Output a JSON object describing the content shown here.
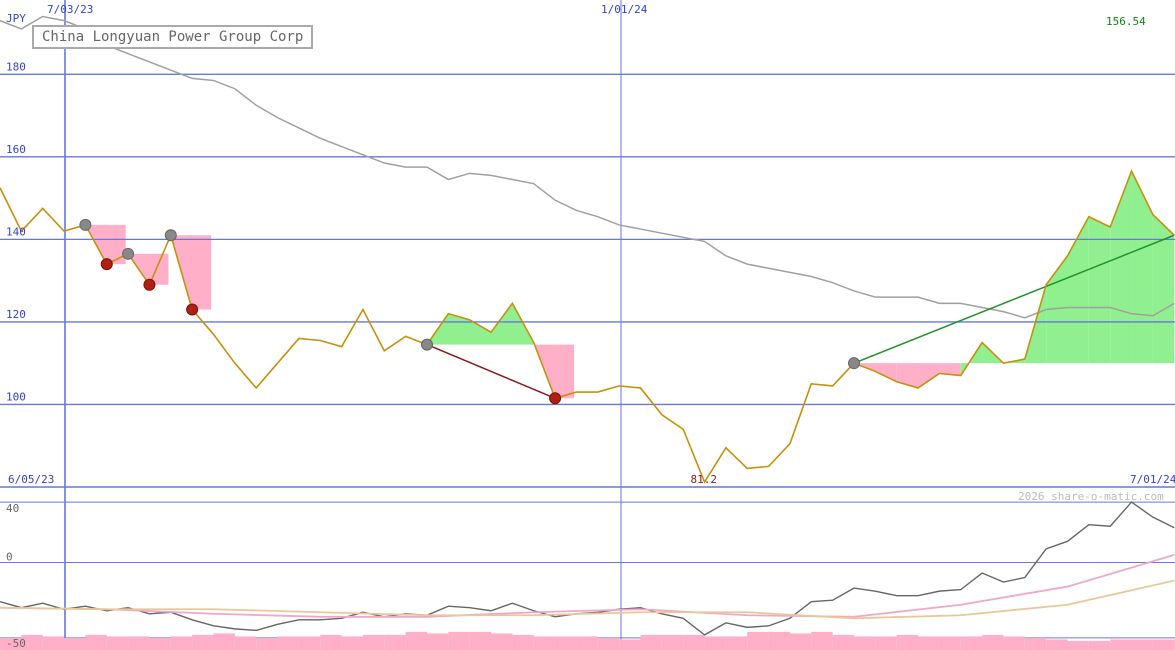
{
  "title": "China Longyuan Power Group Corp",
  "copyright": "2026 share-o-matic.com",
  "colors": {
    "price": "#c8900a",
    "ma_long": "#a0a0a0",
    "grid": "#6677dd",
    "up_fill": "#90f090",
    "down_fill": "#ffb0c8",
    "up_trend": "#22922a",
    "down_trend": "#8b1a1a",
    "last_price": "#118811",
    "low_label": "#8b1a1a"
  },
  "chart_data": [
    {
      "type": "line",
      "panel": "price",
      "ylabel": "JPY",
      "y_ticks": [
        100,
        120,
        140,
        160,
        180
      ],
      "ylim": [
        80,
        198
      ],
      "xlim": [
        "6/05/23",
        "7/01/24"
      ],
      "date_labels": [
        "6/05/23",
        "7/03/23",
        "1/01/24",
        "7/01/24"
      ],
      "date_lines": [
        "7/03/23",
        "1/01/24"
      ],
      "last_price_label": "156.54",
      "low_label": "81.2",
      "series": [
        {
          "role": "price",
          "values": [
            [
              0,
              152.5
            ],
            [
              1,
              142
            ],
            [
              2,
              147.5
            ],
            [
              3,
              142
            ],
            [
              4,
              143.5
            ],
            [
              5,
              134
            ],
            [
              6,
              136.5
            ],
            [
              7,
              129
            ],
            [
              8,
              141
            ],
            [
              9,
              123
            ],
            [
              10,
              117
            ],
            [
              11,
              110
            ],
            [
              12,
              104
            ],
            [
              13,
              110
            ],
            [
              14,
              116
            ],
            [
              15,
              115.5
            ],
            [
              16,
              114
            ],
            [
              17,
              123
            ],
            [
              18,
              113
            ],
            [
              19,
              116.5
            ],
            [
              20,
              114.5
            ],
            [
              21,
              122
            ],
            [
              22,
              120.5
            ],
            [
              23,
              117.5
            ],
            [
              24,
              124.5
            ],
            [
              25,
              115
            ],
            [
              26,
              101.5
            ],
            [
              27,
              103
            ],
            [
              28,
              103
            ],
            [
              29,
              104.5
            ],
            [
              30,
              104
            ],
            [
              31,
              97.5
            ],
            [
              32,
              94
            ],
            [
              33,
              81.2
            ],
            [
              34,
              89.5
            ],
            [
              35,
              84.5
            ],
            [
              36,
              85
            ],
            [
              37,
              90.5
            ],
            [
              38,
              105
            ],
            [
              39,
              104.5
            ],
            [
              40,
              110
            ],
            [
              41,
              108
            ],
            [
              42,
              105.5
            ],
            [
              43,
              104
            ],
            [
              44,
              107.5
            ],
            [
              45,
              107
            ],
            [
              46,
              115
            ],
            [
              47,
              110
            ],
            [
              48,
              111
            ],
            [
              49,
              129
            ],
            [
              50,
              136
            ],
            [
              51,
              145.5
            ],
            [
              52,
              143
            ],
            [
              53,
              156.54
            ],
            [
              54,
              146
            ],
            [
              55,
              141
            ]
          ]
        },
        {
          "role": "long_moving_average",
          "values": [
            [
              0,
              193
            ],
            [
              1,
              191
            ],
            [
              2,
              194
            ],
            [
              3,
              193
            ],
            [
              4,
              191
            ],
            [
              5,
              187
            ],
            [
              6,
              185
            ],
            [
              7,
              183
            ],
            [
              8,
              181
            ],
            [
              9,
              179
            ],
            [
              10,
              178.5
            ],
            [
              11,
              176.5
            ],
            [
              12,
              172.5
            ],
            [
              13,
              169.5
            ],
            [
              14,
              167
            ],
            [
              15,
              164.5
            ],
            [
              16,
              162.5
            ],
            [
              17,
              160.5
            ],
            [
              18,
              158.5
            ],
            [
              19,
              157.5
            ],
            [
              20,
              157.5
            ],
            [
              21,
              154.5
            ],
            [
              22,
              156
            ],
            [
              23,
              155.5
            ],
            [
              24,
              154.5
            ],
            [
              25,
              153.5
            ],
            [
              26,
              149.5
            ],
            [
              27,
              147
            ],
            [
              28,
              145.5
            ],
            [
              29,
              143.5
            ],
            [
              30,
              142.5
            ],
            [
              31,
              141.5
            ],
            [
              32,
              140.5
            ],
            [
              33,
              139.5
            ],
            [
              34,
              136
            ],
            [
              35,
              134
            ],
            [
              36,
              133
            ],
            [
              37,
              132
            ],
            [
              38,
              131
            ],
            [
              39,
              129.5
            ],
            [
              40,
              127.5
            ],
            [
              41,
              126
            ],
            [
              42,
              126
            ],
            [
              43,
              126
            ],
            [
              44,
              124.5
            ],
            [
              45,
              124.5
            ],
            [
              46,
              123.5
            ],
            [
              47,
              122.5
            ],
            [
              48,
              121
            ],
            [
              49,
              123
            ],
            [
              50,
              123.5
            ],
            [
              51,
              123.5
            ],
            [
              52,
              123.5
            ],
            [
              53,
              122
            ],
            [
              54,
              121.5
            ],
            [
              55,
              124.5
            ]
          ]
        }
      ],
      "signals": [
        {
          "kind": "sell",
          "from": [
            4,
            143.5
          ],
          "to": [
            5,
            134
          ]
        },
        {
          "kind": "sell",
          "from": [
            6,
            136.5
          ],
          "to": [
            7,
            129
          ]
        },
        {
          "kind": "sell",
          "from": [
            8,
            141
          ],
          "to": [
            9,
            123
          ]
        },
        {
          "kind": "sell",
          "from": [
            20,
            114.5
          ],
          "to": [
            26,
            101.5
          ]
        },
        {
          "kind": "buy",
          "from": [
            40,
            110
          ],
          "to": [
            55,
            141
          ]
        }
      ]
    },
    {
      "type": "line",
      "panel": "oscillator",
      "y_ticks": [
        -50,
        0,
        40
      ],
      "ylim": [
        -58,
        48
      ],
      "series": [
        {
          "role": "oscillator",
          "values": [
            [
              0,
              -26
            ],
            [
              1,
              -30
            ],
            [
              2,
              -27
            ],
            [
              3,
              -31
            ],
            [
              4,
              -29
            ],
            [
              5,
              -32
            ],
            [
              6,
              -30
            ],
            [
              7,
              -34
            ],
            [
              8,
              -33
            ],
            [
              9,
              -38
            ],
            [
              10,
              -42
            ],
            [
              11,
              -44
            ],
            [
              12,
              -45
            ],
            [
              13,
              -41
            ],
            [
              14,
              -38
            ],
            [
              15,
              -38
            ],
            [
              16,
              -37
            ],
            [
              17,
              -33
            ],
            [
              18,
              -36
            ],
            [
              19,
              -34
            ],
            [
              20,
              -35
            ],
            [
              21,
              -29
            ],
            [
              22,
              -30
            ],
            [
              23,
              -32
            ],
            [
              24,
              -27
            ],
            [
              25,
              -32
            ],
            [
              26,
              -36
            ],
            [
              27,
              -34
            ],
            [
              28,
              -33
            ],
            [
              29,
              -31
            ],
            [
              30,
              -30
            ],
            [
              31,
              -34
            ],
            [
              32,
              -37
            ],
            [
              33,
              -48
            ],
            [
              34,
              -40
            ],
            [
              35,
              -43
            ],
            [
              36,
              -42
            ],
            [
              37,
              -37
            ],
            [
              38,
              -26
            ],
            [
              39,
              -25
            ],
            [
              40,
              -17
            ],
            [
              41,
              -19
            ],
            [
              42,
              -22
            ],
            [
              43,
              -22
            ],
            [
              44,
              -19
            ],
            [
              45,
              -18
            ],
            [
              46,
              -7
            ],
            [
              47,
              -13
            ],
            [
              48,
              -10
            ],
            [
              49,
              9
            ],
            [
              50,
              14
            ],
            [
              51,
              25
            ],
            [
              52,
              24
            ],
            [
              53,
              40
            ],
            [
              54,
              30
            ],
            [
              55,
              23
            ]
          ]
        },
        {
          "role": "oscillator_average_fast",
          "values": [
            [
              0,
              -30
            ],
            [
              5,
              -31
            ],
            [
              10,
              -34
            ],
            [
              15,
              -36
            ],
            [
              20,
              -36
            ],
            [
              25,
              -33
            ],
            [
              30,
              -31
            ],
            [
              35,
              -35
            ],
            [
              40,
              -36
            ],
            [
              45,
              -28
            ],
            [
              50,
              -16
            ],
            [
              55,
              5
            ]
          ]
        },
        {
          "role": "oscillator_average_slow",
          "values": [
            [
              0,
              -30
            ],
            [
              5,
              -31
            ],
            [
              10,
              -31
            ],
            [
              15,
              -33
            ],
            [
              20,
              -35
            ],
            [
              25,
              -35
            ],
            [
              30,
              -33
            ],
            [
              35,
              -33
            ],
            [
              40,
              -37
            ],
            [
              45,
              -35
            ],
            [
              50,
              -28
            ],
            [
              55,
              -12
            ]
          ]
        }
      ],
      "histogram": [
        [
          0,
          -50
        ],
        [
          1,
          -48
        ],
        [
          2,
          -49
        ],
        [
          3,
          -50
        ],
        [
          4,
          -48
        ],
        [
          5,
          -49
        ],
        [
          6,
          -49
        ],
        [
          7,
          -50
        ],
        [
          8,
          -49
        ],
        [
          9,
          -48
        ],
        [
          10,
          -47
        ],
        [
          11,
          -49
        ],
        [
          12,
          -50
        ],
        [
          13,
          -49
        ],
        [
          14,
          -49
        ],
        [
          15,
          -48
        ],
        [
          16,
          -49
        ],
        [
          17,
          -48
        ],
        [
          18,
          -48
        ],
        [
          19,
          -46
        ],
        [
          20,
          -47
        ],
        [
          21,
          -46
        ],
        [
          22,
          -46
        ],
        [
          23,
          -47
        ],
        [
          24,
          -48
        ],
        [
          25,
          -49
        ],
        [
          26,
          -49
        ],
        [
          27,
          -49
        ],
        [
          28,
          -50
        ],
        [
          29,
          -51
        ],
        [
          30,
          -48
        ],
        [
          31,
          -48
        ],
        [
          32,
          -48
        ],
        [
          33,
          -49
        ],
        [
          34,
          -49
        ],
        [
          35,
          -46
        ],
        [
          36,
          -46
        ],
        [
          37,
          -47
        ],
        [
          38,
          -46
        ],
        [
          39,
          -48
        ],
        [
          40,
          -49
        ],
        [
          41,
          -49
        ],
        [
          42,
          -48
        ],
        [
          43,
          -49
        ],
        [
          44,
          -49
        ],
        [
          45,
          -49
        ],
        [
          46,
          -48
        ],
        [
          47,
          -49
        ],
        [
          48,
          -50
        ],
        [
          49,
          -51
        ],
        [
          50,
          -52
        ],
        [
          51,
          -52
        ],
        [
          52,
          -51
        ],
        [
          53,
          -51
        ],
        [
          54,
          -51
        ],
        [
          55,
          -51
        ]
      ]
    }
  ]
}
